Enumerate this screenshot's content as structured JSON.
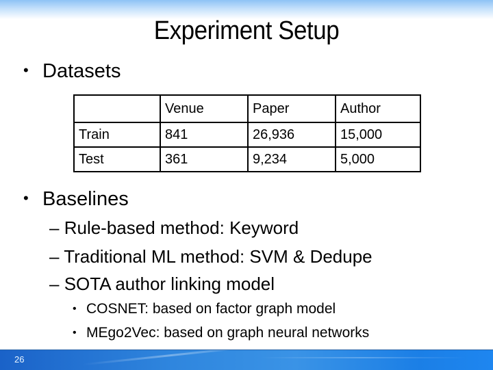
{
  "slide": {
    "title": "Experiment Setup",
    "page_number": "26"
  },
  "datasets": {
    "heading": "Datasets",
    "table": {
      "headers": [
        "",
        "Venue",
        "Paper",
        "Author"
      ],
      "rows": [
        [
          "Train",
          "841",
          "26,936",
          "15,000"
        ],
        [
          "Test",
          "361",
          "9,234",
          "5,000"
        ]
      ]
    }
  },
  "baselines": {
    "heading": "Baselines",
    "items": [
      "Rule-based method: Keyword",
      "Traditional ML method: SVM & Dedupe",
      "SOTA author linking model"
    ],
    "sub_items": [
      "COSNET: based on factor graph model",
      "MEgo2Vec: based on graph neural networks"
    ]
  },
  "glyphs": {
    "bullet": "•",
    "dash": "–"
  },
  "colors": {
    "footer_blue": "#2f86de",
    "top_band": "#8ec3f5"
  }
}
